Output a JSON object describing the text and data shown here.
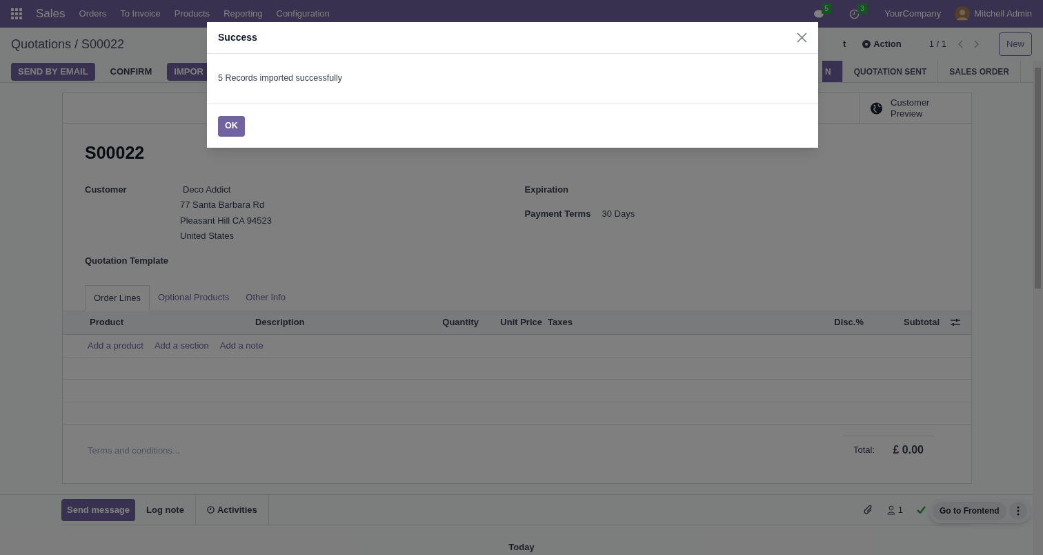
{
  "navbar": {
    "app": "Sales",
    "menu": [
      "Orders",
      "To Invoice",
      "Products",
      "Reporting",
      "Configuration"
    ],
    "messages_count": "5",
    "activities_count": "3",
    "company": "YourCompany",
    "user": "Mitchell Admin"
  },
  "control_panel": {
    "breadcrumb": "Quotations / S00022",
    "print_partial": "t",
    "action": "Action",
    "pager": "1 / 1",
    "new": "New"
  },
  "actions": [
    {
      "label": "SEND BY EMAIL",
      "primary": true
    },
    {
      "label": "CONFIRM",
      "primary": false
    },
    {
      "label": "IMPOR",
      "primary": true
    }
  ],
  "status_steps": [
    {
      "label": "N",
      "selected": true
    },
    {
      "label": "QUOTATION SENT",
      "selected": false
    },
    {
      "label": "SALES ORDER",
      "selected": false
    }
  ],
  "smart_button": {
    "label": "Customer Preview"
  },
  "form": {
    "name": "S00022",
    "customer_label": "Customer",
    "customer": "Deco Addict",
    "address": [
      "77 Santa Barbara Rd",
      "Pleasant Hill CA 94523",
      "United States"
    ],
    "template_label": "Quotation Template",
    "expiration_label": "Expiration",
    "payment_terms_label": "Payment Terms",
    "payment_terms": "30 Days"
  },
  "tabs": [
    {
      "label": "Order Lines",
      "selected": true
    },
    {
      "label": "Optional Products",
      "selected": false
    },
    {
      "label": "Other Info",
      "selected": false
    }
  ],
  "table": {
    "columns": [
      "Product",
      "Description",
      "Quantity",
      "Unit Price",
      "Taxes",
      "Disc.%",
      "Subtotal"
    ],
    "add_links": [
      "Add a product",
      "Add a section",
      "Add a note"
    ]
  },
  "terms_placeholder": "Terms and conditions...",
  "total_label": "Total:",
  "total": "£ 0.00",
  "chatter": {
    "send": "Send message",
    "log": "Log note",
    "activities": "Activities",
    "followers": "1",
    "frontend": "Go to Frontend",
    "today": "Today"
  },
  "dialog": {
    "title": "Success",
    "message": "5 Records imported successfully",
    "ok": "OK"
  }
}
